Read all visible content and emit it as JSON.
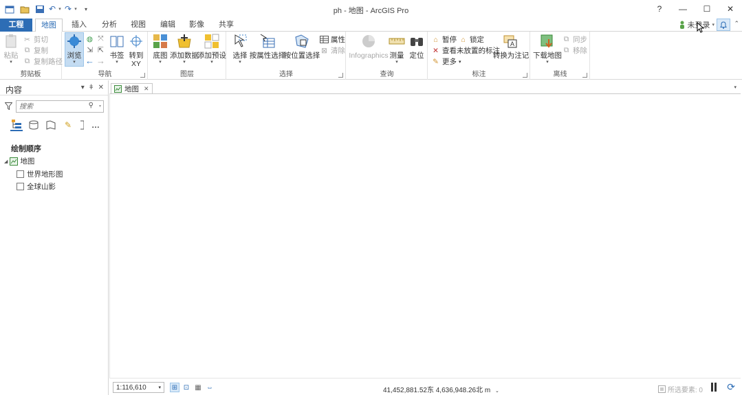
{
  "window": {
    "title": "ph - 地图 - ArcGIS Pro",
    "help": "?",
    "minimize": "—",
    "maximize": "☐",
    "close": "✕"
  },
  "quick_access": {
    "icons": [
      "new-project-icon",
      "open-project-icon",
      "save-project-icon",
      "undo-icon",
      "redo-icon",
      "customize-icon"
    ],
    "undo_glyph": "↶",
    "redo_glyph": "↷",
    "customize_glyph": "▾"
  },
  "tabs": {
    "project": "工程",
    "items": [
      "地图",
      "插入",
      "分析",
      "视图",
      "编辑",
      "影像",
      "共享"
    ],
    "active": "地图"
  },
  "account": {
    "signin_label": "未登录",
    "caret": "▾",
    "bell": "🔔",
    "collapse": "⌃"
  },
  "ribbon": {
    "clipboard": {
      "label": "剪贴板",
      "paste": "粘贴",
      "cut": "剪切",
      "copy": "复制",
      "copy_path": "复制路径"
    },
    "navigate": {
      "label": "导航",
      "explore": "浏览",
      "bookmarks": "书签",
      "goto_xy": "转到\nXY",
      "goto_line1": "转到",
      "goto_line2": "XY"
    },
    "layer": {
      "label": "图层",
      "basemap": "底图",
      "add_data": "添加数据",
      "add_preset": "添加预设"
    },
    "selection": {
      "label": "选择",
      "select": "选择",
      "by_attributes": "按属性选择",
      "by_location": "按位置选择",
      "attributes": "属性",
      "clear": "清除"
    },
    "inquiry": {
      "label": "查询",
      "infographics": "Infographics",
      "measure": "测量",
      "locate": "定位"
    },
    "labeling": {
      "label": "标注",
      "pause": "暂停",
      "lock": "锁定",
      "view_unplaced": "查看未放置的标注",
      "more": "更多",
      "convert": "转换为注记"
    },
    "offline": {
      "label": "离线",
      "download_map": "下载地图",
      "sync": "同步",
      "remove": "移除"
    }
  },
  "contents": {
    "title": "内容",
    "pin": "▾ ⇟ ✕",
    "ctrl_dropdown": "▾",
    "ctrl_pin": "ǂ",
    "ctrl_close": "✕",
    "search_placeholder": "搜索",
    "search_icon": "⚲",
    "draw_order_label": "绘制顺序",
    "map_node": "地图",
    "layers": [
      {
        "name": "世界地形图",
        "checked": false
      },
      {
        "name": "全球山影",
        "checked": false
      }
    ],
    "more": "…"
  },
  "map_view": {
    "tab_label": "地图",
    "tab_close": "✕",
    "scale": "1:116,610",
    "scale_caret": "▾",
    "coordinates": "41,452,881.52东 4,636,948.26北 m",
    "coords_caret": "⌄",
    "selected_features": "所选要素: 0"
  },
  "colors": {
    "accent": "#2d6db5",
    "project_tab": "#2d6db5",
    "selected_button": "#c4dcf2",
    "disabled_text": "#a8a8a8"
  }
}
